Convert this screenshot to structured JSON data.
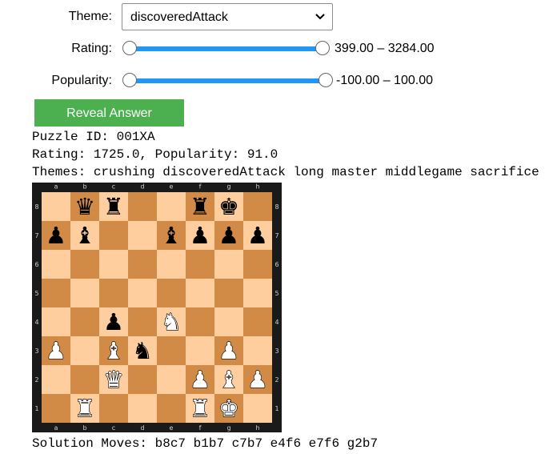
{
  "controls": {
    "theme_label": "Theme:",
    "theme_value": "discoveredAttack",
    "rating_label": "Rating:",
    "rating_range": "399.00 – 3284.00",
    "popularity_label": "Popularity:",
    "popularity_range": "-100.00 – 100.00",
    "reveal_label": "Reveal Answer"
  },
  "info": {
    "puzzle_id": "Puzzle ID: 001XA",
    "rating_line": "Rating: 1725.0, Popularity: 91.0",
    "themes_line": "Themes: crushing discoveredAttack long master middlegame sacrifice",
    "solution_line": "Solution Moves: b8c7 b1b7 c7b7 e4f6 e7f6 g2b7"
  },
  "board": {
    "files": [
      "a",
      "b",
      "c",
      "d",
      "e",
      "f",
      "g",
      "h"
    ],
    "ranks": [
      "8",
      "7",
      "6",
      "5",
      "4",
      "3",
      "2",
      "1"
    ],
    "light_color": "#ffce9e",
    "dark_color": "#d18b47",
    "pieces": [
      {
        "square": "b8",
        "glyph": "♛",
        "color": "black",
        "name": "black-queen-icon"
      },
      {
        "square": "c8",
        "glyph": "♜",
        "color": "black",
        "name": "black-rook-icon"
      },
      {
        "square": "f8",
        "glyph": "♜",
        "color": "black",
        "name": "black-rook-icon"
      },
      {
        "square": "g8",
        "glyph": "♚",
        "color": "black",
        "name": "black-king-icon"
      },
      {
        "square": "a7",
        "glyph": "♟",
        "color": "black",
        "name": "black-pawn-icon"
      },
      {
        "square": "b7",
        "glyph": "♝",
        "color": "black",
        "name": "black-bishop-icon"
      },
      {
        "square": "e7",
        "glyph": "♝",
        "color": "black",
        "name": "black-bishop-icon"
      },
      {
        "square": "f7",
        "glyph": "♟",
        "color": "black",
        "name": "black-pawn-icon"
      },
      {
        "square": "g7",
        "glyph": "♟",
        "color": "black",
        "name": "black-pawn-icon"
      },
      {
        "square": "h7",
        "glyph": "♟",
        "color": "black",
        "name": "black-pawn-icon"
      },
      {
        "square": "c4",
        "glyph": "♟",
        "color": "black",
        "name": "black-pawn-icon"
      },
      {
        "square": "e4",
        "glyph": "♞",
        "color": "white",
        "name": "white-knight-icon"
      },
      {
        "square": "a3",
        "glyph": "♟",
        "color": "white",
        "name": "white-pawn-icon"
      },
      {
        "square": "c3",
        "glyph": "♝",
        "color": "white",
        "name": "white-bishop-icon"
      },
      {
        "square": "d3",
        "glyph": "♞",
        "color": "black",
        "name": "black-knight-icon"
      },
      {
        "square": "g3",
        "glyph": "♟",
        "color": "white",
        "name": "white-pawn-icon"
      },
      {
        "square": "c2",
        "glyph": "♛",
        "color": "white",
        "name": "white-queen-icon"
      },
      {
        "square": "f2",
        "glyph": "♟",
        "color": "white",
        "name": "white-pawn-icon"
      },
      {
        "square": "g2",
        "glyph": "♝",
        "color": "white",
        "name": "white-bishop-icon"
      },
      {
        "square": "h2",
        "glyph": "♟",
        "color": "white",
        "name": "white-pawn-icon"
      },
      {
        "square": "b1",
        "glyph": "♜",
        "color": "white",
        "name": "white-rook-icon"
      },
      {
        "square": "f1",
        "glyph": "♜",
        "color": "white",
        "name": "white-rook-icon"
      },
      {
        "square": "g1",
        "glyph": "♚",
        "color": "white",
        "name": "white-king-icon"
      }
    ]
  }
}
